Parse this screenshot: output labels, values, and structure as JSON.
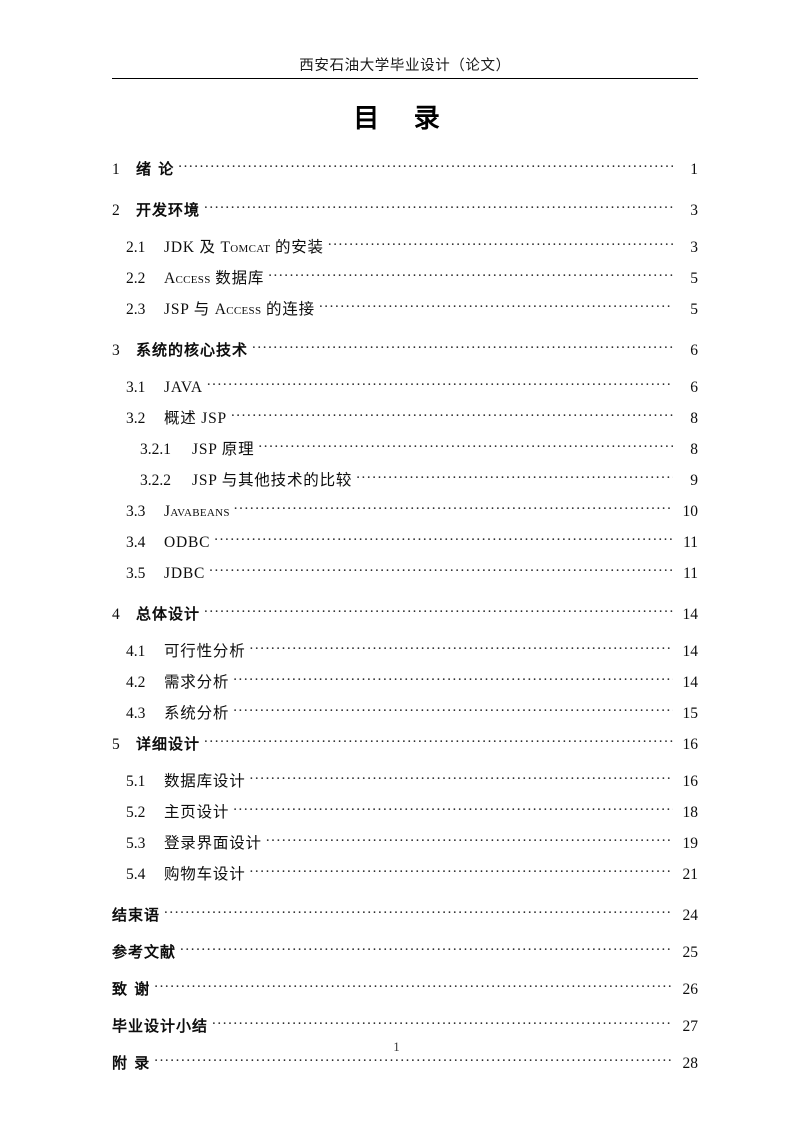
{
  "header": {
    "running_title": "西安石油大学毕业设计（论文）"
  },
  "title": "目 录",
  "footer": {
    "page_number": "1"
  },
  "toc": {
    "entries": [
      {
        "level": 1,
        "number": "1",
        "label": "绪   论",
        "page": "1",
        "gap": "none"
      },
      {
        "level": 1,
        "number": "2",
        "label": "开发环境",
        "page": "3",
        "gap": "large"
      },
      {
        "level": 2,
        "number": "2.1",
        "label": "JDK 及 TOMCAT 的安装",
        "page": "3",
        "gap": "small"
      },
      {
        "level": 2,
        "number": "2.2",
        "label": "ACCESS 数据库",
        "page": "5",
        "gap": "none"
      },
      {
        "level": 2,
        "number": "2.3",
        "label": "JSP 与 ACCESS 的连接",
        "page": "5",
        "gap": "none"
      },
      {
        "level": 1,
        "number": "3",
        "label": "系统的核心技术",
        "page": "6",
        "gap": "large"
      },
      {
        "level": 2,
        "number": "3.1",
        "label": "JAVA",
        "page": "6",
        "gap": "small"
      },
      {
        "level": 2,
        "number": "3.2",
        "label": "概述 JSP",
        "page": "8",
        "gap": "none"
      },
      {
        "level": 3,
        "number": "3.2.1",
        "label": "JSP 原理",
        "page": "8",
        "gap": "none"
      },
      {
        "level": 3,
        "number": "3.2.2",
        "label": "JSP 与其他技术的比较",
        "page": "9",
        "gap": "none"
      },
      {
        "level": 2,
        "number": "3.3",
        "label": "JAVABEANS",
        "page": "10",
        "gap": "none"
      },
      {
        "level": 2,
        "number": "3.4",
        "label": "ODBC",
        "page": "11",
        "gap": "none"
      },
      {
        "level": 2,
        "number": "3.5",
        "label": "JDBC",
        "page": "11",
        "gap": "none"
      },
      {
        "level": 1,
        "number": "4",
        "label": "总体设计",
        "page": "14",
        "gap": "large"
      },
      {
        "level": 2,
        "number": "4.1",
        "label": "可行性分析",
        "page": "14",
        "gap": "small"
      },
      {
        "level": 2,
        "number": "4.2",
        "label": "需求分析",
        "page": "14",
        "gap": "none"
      },
      {
        "level": 2,
        "number": "4.3",
        "label": "系统分析",
        "page": "15",
        "gap": "none"
      },
      {
        "level": 1,
        "number": "5",
        "label": "详细设计",
        "page": "16",
        "gap": "none"
      },
      {
        "level": 2,
        "number": "5.1",
        "label": "数据库设计",
        "page": "16",
        "gap": "small"
      },
      {
        "level": 2,
        "number": "5.2",
        "label": "主页设计",
        "page": "18",
        "gap": "none"
      },
      {
        "level": 2,
        "number": "5.3",
        "label": "登录界面设计",
        "page": "19",
        "gap": "none"
      },
      {
        "level": 2,
        "number": "5.4",
        "label": "购物车设计",
        "page": "21",
        "gap": "none"
      },
      {
        "level": 0,
        "number": "",
        "label": "结束语",
        "page": "24",
        "gap": "large"
      },
      {
        "level": 0,
        "number": "",
        "label": "参考文献",
        "page": "25",
        "gap": "small"
      },
      {
        "level": 0,
        "number": "",
        "label": "致   谢",
        "page": "26",
        "gap": "small"
      },
      {
        "level": 0,
        "number": "",
        "label": "毕业设计小结",
        "page": "27",
        "gap": "small"
      },
      {
        "level": 0,
        "number": "",
        "label": "附   录",
        "page": "28",
        "gap": "small"
      }
    ]
  }
}
